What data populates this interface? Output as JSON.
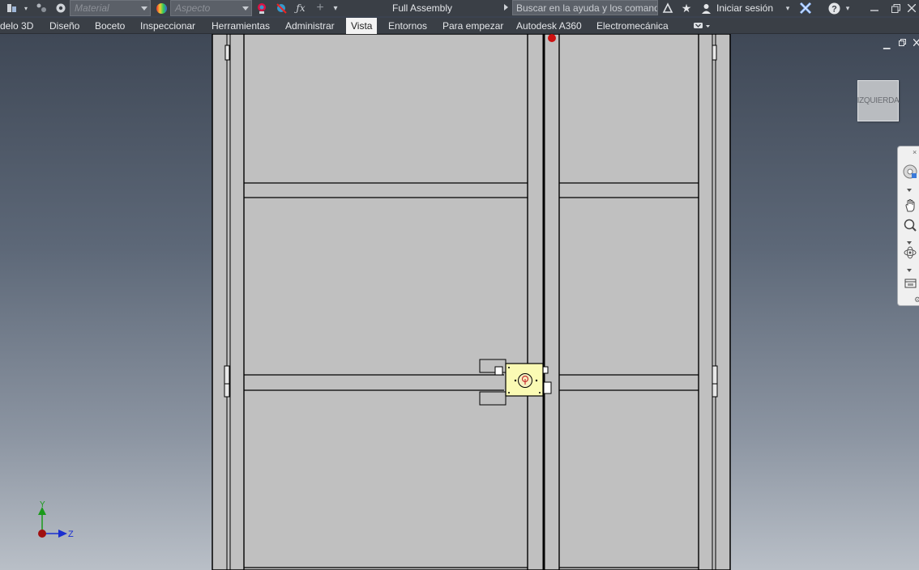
{
  "titlebar": {
    "material_placeholder": "Material",
    "aspect_placeholder": "Aspecto",
    "fx_symbol": "ƒx",
    "plus_symbol": "+",
    "document_title": "Full Assembly",
    "search_placeholder": "Buscar en la ayuda y los comandos...",
    "signin_label": "Iniciar sesión",
    "help_label": "?"
  },
  "ribbon": {
    "tabs": [
      {
        "label": "delo 3D"
      },
      {
        "label": "Diseño"
      },
      {
        "label": "Boceto"
      },
      {
        "label": "Inspeccionar"
      },
      {
        "label": "Herramientas"
      },
      {
        "label": "Administrar"
      },
      {
        "label": "Vista"
      },
      {
        "label": "Entornos"
      },
      {
        "label": "Para empezar"
      },
      {
        "label": "Autodesk A360"
      },
      {
        "label": "Electromecánica"
      }
    ],
    "active_tab": "Vista"
  },
  "viewport": {
    "viewcube_label": "IZQUIERDA",
    "triad": {
      "y_label": "Y",
      "z_label": "Z"
    }
  },
  "colors": {
    "titlebar_bg": "#3a3f46",
    "panel_fill": "#c0c0c0",
    "lock_body": "#fafab4",
    "marker_red": "#cc1111",
    "axis_y": "#1a9a1a",
    "axis_z": "#1a2fd0"
  },
  "icons": [
    "app-menu-icon",
    "appearance-sphere-icon",
    "color-override-icon",
    "clear-override-icon",
    "function-icon",
    "exchange-icon",
    "star-icon",
    "user-icon",
    "autodesk-x-icon",
    "help-icon",
    "pan-icon",
    "zoom-icon",
    "orbit-icon",
    "look-at-icon"
  ]
}
